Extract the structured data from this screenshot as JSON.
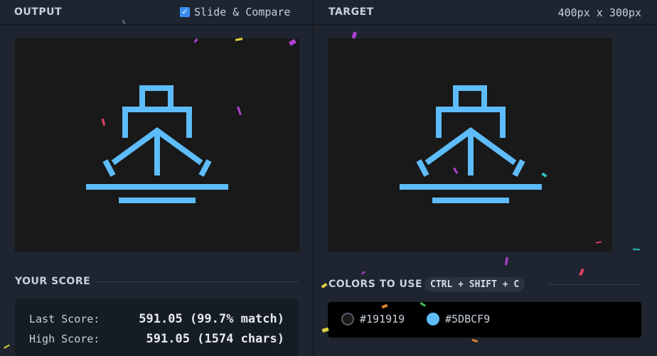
{
  "output_panel": {
    "title": "OUTPUT",
    "slide_compare": {
      "label": "Slide & Compare",
      "checked": true
    }
  },
  "target_panel": {
    "title": "TARGET",
    "dimensions": "400px x 300px"
  },
  "canvas": {
    "background": "#191919",
    "icon": "ship-icon",
    "icon_color": "#5DBCF9"
  },
  "score": {
    "title": "YOUR SCORE",
    "last_label": "Last Score:",
    "last_value": "591.05 (99.7% match)",
    "high_label": "High Score:",
    "high_value": "591.05 (1574 chars)"
  },
  "colors": {
    "title": "COLORS TO USE",
    "shortcut": "CTRL + SHIFT + C",
    "items": [
      {
        "hex": "#191919",
        "label": "#191919"
      },
      {
        "hex": "#5DBCF9",
        "label": "#5DBCF9"
      }
    ]
  },
  "accent": {
    "checkbox": "#3b8ef0",
    "confetti_colors": [
      "#b040d0",
      "#e0d040",
      "#e04060",
      "#30c0c0",
      "#e08030",
      "#40c060"
    ]
  }
}
